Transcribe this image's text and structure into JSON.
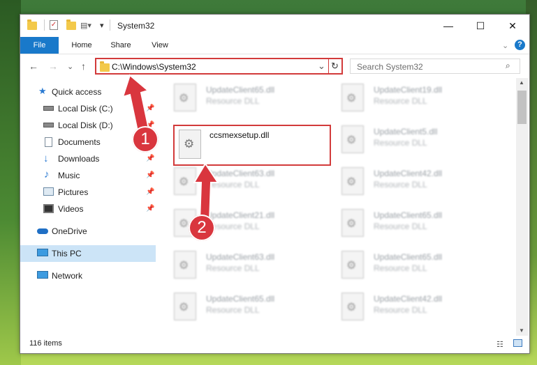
{
  "window": {
    "title": "System32"
  },
  "titlebar": {
    "minimize": "—",
    "maximize": "☐",
    "close": "✕",
    "help": "?"
  },
  "ribbon": {
    "tabs": [
      "File",
      "Home",
      "Share",
      "View"
    ]
  },
  "addressbar": {
    "path": "C:\\Windows\\System32",
    "refresh": "↻",
    "dropdown": "⌄"
  },
  "search": {
    "placeholder": "Search System32",
    "icon": "search-icon"
  },
  "nav": {
    "back": "←",
    "forward": "→",
    "recent": "⌄",
    "up": "↑",
    "items": [
      {
        "label": "Quick access",
        "icon": "star-icon"
      },
      {
        "label": "Local Disk (C:)",
        "icon": "drive-icon"
      },
      {
        "label": "Local Disk (D:)",
        "icon": "drive-icon"
      },
      {
        "label": "Documents",
        "icon": "documents-icon"
      },
      {
        "label": "Downloads",
        "icon": "download-icon"
      },
      {
        "label": "Music",
        "icon": "music-icon"
      },
      {
        "label": "Pictures",
        "icon": "pictures-icon"
      },
      {
        "label": "Videos",
        "icon": "videos-icon"
      },
      {
        "label": "OneDrive",
        "icon": "cloud-icon"
      },
      {
        "label": "This PC",
        "icon": "computer-icon"
      },
      {
        "label": "Network",
        "icon": "network-icon"
      }
    ]
  },
  "files": [
    {
      "name": "UpdateClient65.dll",
      "type": "Resource DLL"
    },
    {
      "name": "UpdateClient19.dll",
      "type": "Resource DLL"
    },
    {
      "name": "ccsmexsetup.dll",
      "type": ""
    },
    {
      "name": "UpdateClient5.dll",
      "type": "Resource DLL"
    },
    {
      "name": "UpdateClient63.dll",
      "type": "Resource DLL"
    },
    {
      "name": "UpdateClient42.dll",
      "type": "Resource DLL"
    },
    {
      "name": "UpdateClient21.dll",
      "type": "Resource DLL"
    },
    {
      "name": "UpdateClient65.dll",
      "type": "Resource DLL"
    },
    {
      "name": "UpdateClient63.dll",
      "type": "Resource DLL"
    },
    {
      "name": "UpdateClient65.dll",
      "type": "Resource DLL"
    },
    {
      "name": "UpdateClient65.dll",
      "type": "Resource DLL"
    },
    {
      "name": "UpdateClient42.dll",
      "type": "Resource DLL"
    }
  ],
  "status": {
    "count": "116 items"
  },
  "annotations": {
    "step1": "1",
    "step2": "2",
    "color": "#d9363e"
  }
}
